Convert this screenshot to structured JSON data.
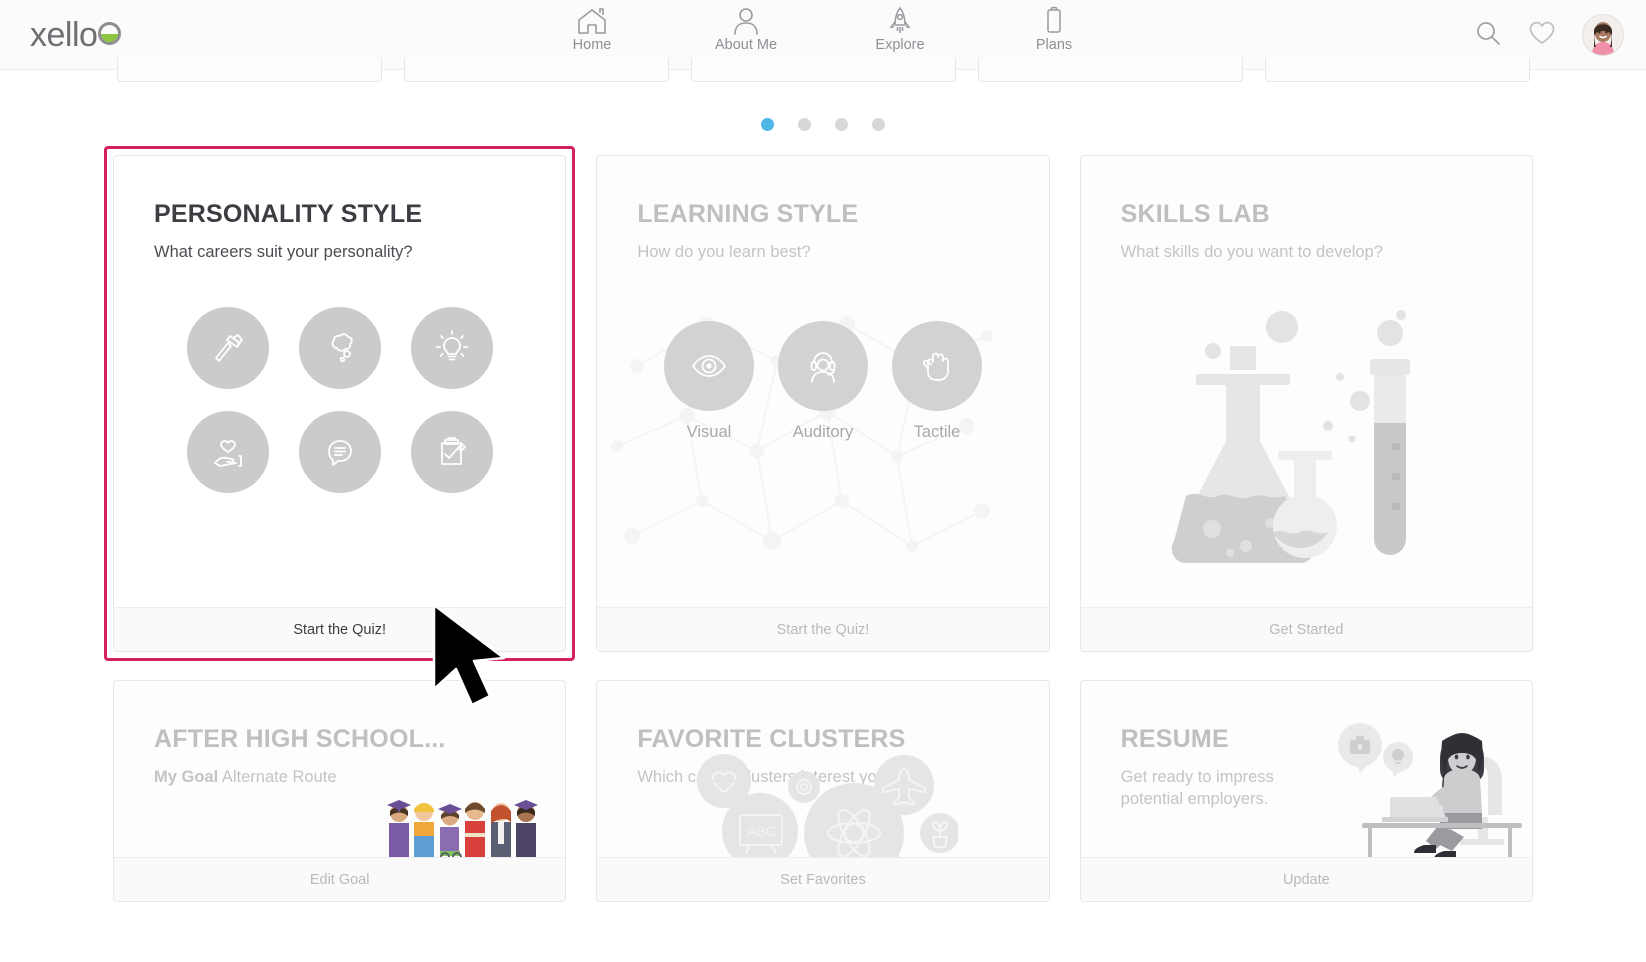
{
  "brand": {
    "name": "xello"
  },
  "nav": {
    "items": [
      {
        "label": "Home",
        "icon": "home-icon",
        "active": true
      },
      {
        "label": "About Me",
        "icon": "person-icon",
        "active": false
      },
      {
        "label": "Explore",
        "icon": "rocket-icon",
        "active": false
      },
      {
        "label": "Plans",
        "icon": "clipboard-icon",
        "active": false
      }
    ],
    "search_icon": "search-icon",
    "favorites_icon": "heart-icon",
    "avatar_label": "User avatar"
  },
  "carousel": {
    "dots": [
      {
        "active": true
      },
      {
        "active": false
      },
      {
        "active": false
      },
      {
        "active": false
      }
    ]
  },
  "colors": {
    "accent_selected": "#d6205a",
    "nav_active_underline": "#b07fd0",
    "dot_active": "#4fb8e8",
    "logo_green": "#8cc63e"
  },
  "cards": [
    {
      "id": "personality-style",
      "title": "PERSONALITY STYLE",
      "subtitle": "What careers suit your personality?",
      "footer_label": "Start the Quiz!",
      "selected": true,
      "icons": [
        "hammer-icon",
        "thought-bubble-icon",
        "lightbulb-icon",
        "hand-heart-icon",
        "speech-bubble-icon",
        "clipboard-pencil-icon"
      ]
    },
    {
      "id": "learning-style",
      "title": "LEARNING STYLE",
      "subtitle": "How do you learn best?",
      "footer_label": "Start the Quiz!",
      "selected": false,
      "styles": [
        {
          "label": "Visual",
          "icon": "eye-icon"
        },
        {
          "label": "Auditory",
          "icon": "headset-person-icon"
        },
        {
          "label": "Tactile",
          "icon": "hand-icon"
        }
      ]
    },
    {
      "id": "skills-lab",
      "title": "SKILLS LAB",
      "subtitle": "What skills do you want to develop?",
      "footer_label": "Get Started",
      "selected": false,
      "art": "lab-flasks-illustration"
    },
    {
      "id": "after-high-school",
      "title": "AFTER HIGH SCHOOL...",
      "subtitle_bold": "My Goal",
      "subtitle_rest": "Alternate Route",
      "footer_label": "Edit Goal",
      "selected": false,
      "art": "graduates-group-illustration"
    },
    {
      "id": "favorite-clusters",
      "title": "FAVORITE CLUSTERS",
      "subtitle": "Which career clusters interest you?",
      "footer_label": "Set Favorites",
      "selected": false,
      "art": "cluster-bubbles-illustration"
    },
    {
      "id": "resume",
      "title": "RESUME",
      "subtitle": "Get ready to impress potential employers.",
      "footer_label": "Update",
      "selected": false,
      "art": "person-at-desk-illustration"
    }
  ]
}
